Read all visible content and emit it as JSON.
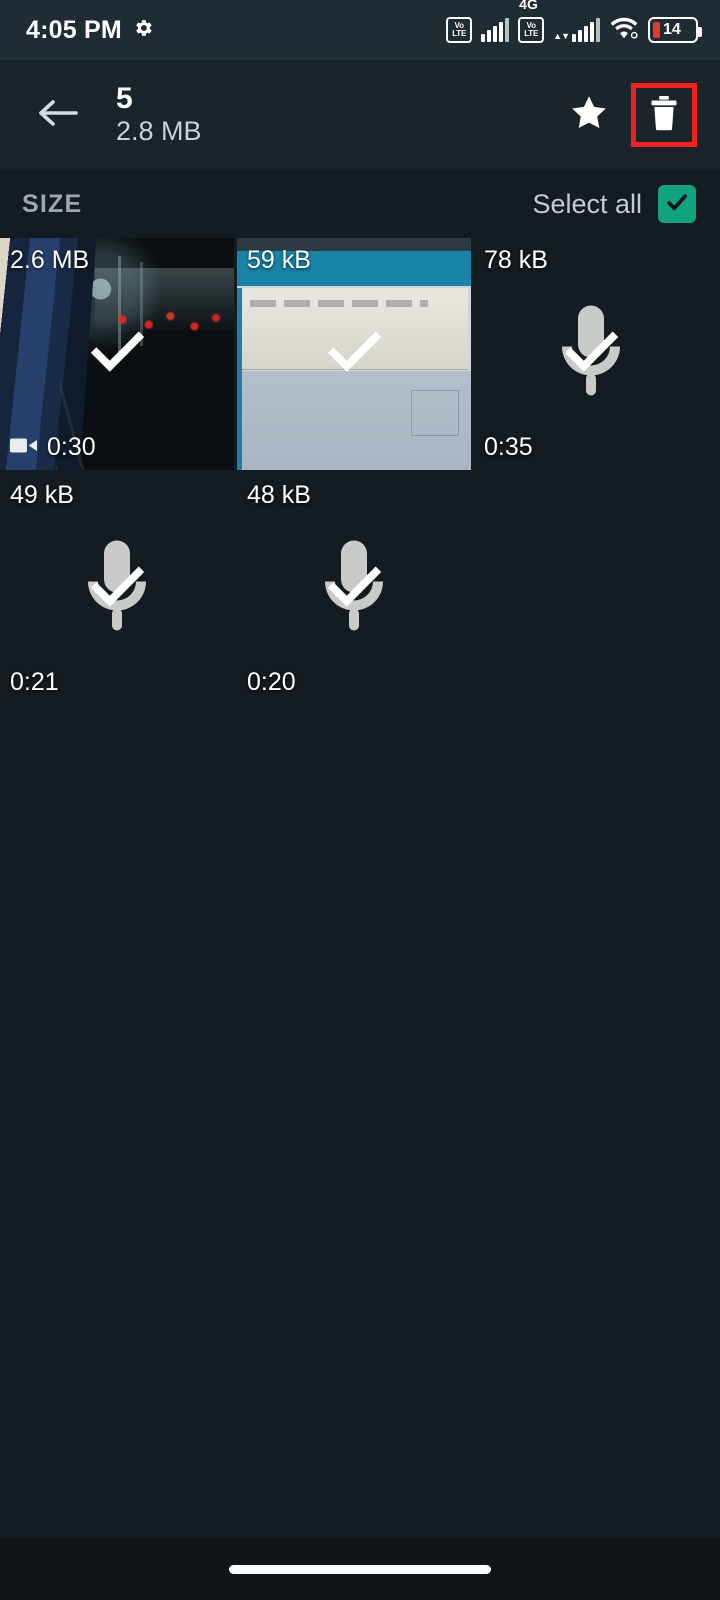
{
  "statusbar": {
    "time": "4:05 PM",
    "settings_icon": "gear-icon",
    "volte1": {
      "top": "Vo",
      "bottom": "LTE"
    },
    "volte2": {
      "top": "Vo",
      "bottom": "LTE"
    },
    "network_type": "4G",
    "wifi_icon": "wifi-icon",
    "battery_level": "14"
  },
  "appbar": {
    "back_icon": "back-arrow-icon",
    "selected_count": "5",
    "total_size": "2.8 MB",
    "star_icon": "star-icon",
    "delete_icon": "trash-icon",
    "highlight_color": "#f32020"
  },
  "section": {
    "title": "SIZE",
    "select_all_label": "Select all",
    "select_all_checked": true,
    "checkbox_color": "#0fa37f"
  },
  "items": [
    {
      "size": "2.6 MB",
      "duration": "0:30",
      "type": "video",
      "selected": true,
      "has_video_icon": true
    },
    {
      "size": "59 kB",
      "duration": "",
      "type": "image",
      "selected": true,
      "has_video_icon": false
    },
    {
      "size": "78 kB",
      "duration": "0:35",
      "type": "audio",
      "selected": true,
      "has_video_icon": false
    },
    {
      "size": "49 kB",
      "duration": "0:21",
      "type": "audio",
      "selected": true,
      "has_video_icon": false
    },
    {
      "size": "48 kB",
      "duration": "0:20",
      "type": "audio",
      "selected": true,
      "has_video_icon": false
    }
  ],
  "navbar": {
    "gesture_pill": "home-gesture-pill"
  }
}
